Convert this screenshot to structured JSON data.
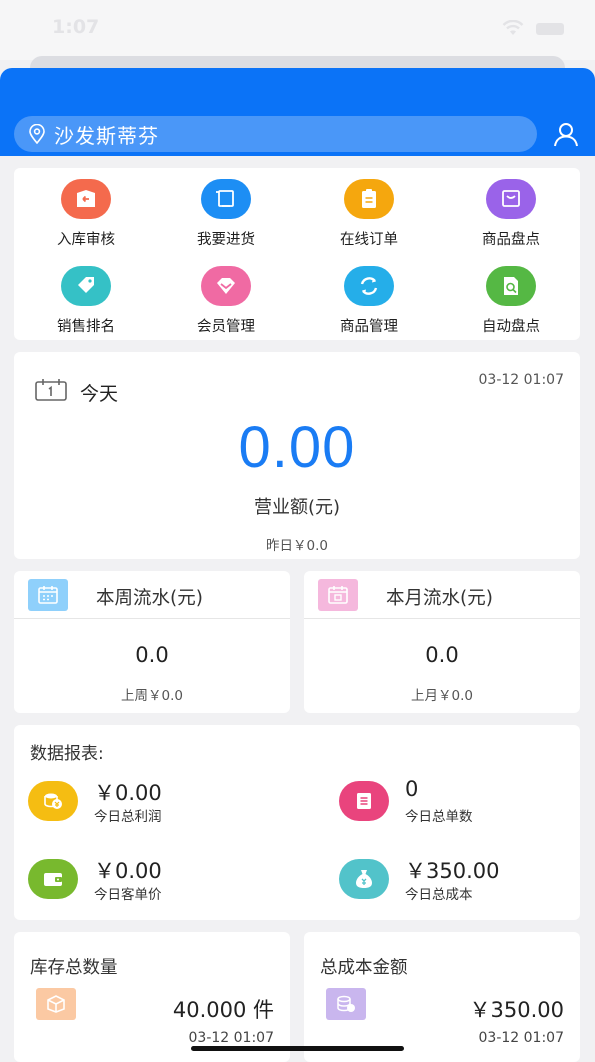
{
  "status_bar": {
    "time": "1:07"
  },
  "header": {
    "store_name": "沙发斯蒂芬"
  },
  "menu": [
    {
      "label": "入库审核",
      "icon": "inbound-review-icon",
      "color": "#f46a4d"
    },
    {
      "label": "我要进货",
      "icon": "purchase-cart-icon",
      "color": "#1d8ef4"
    },
    {
      "label": "在线订单",
      "icon": "clipboard-icon",
      "color": "#f5a70e"
    },
    {
      "label": "商品盘点",
      "icon": "inventory-box-icon",
      "color": "#9a63e9"
    },
    {
      "label": "销售排名",
      "icon": "tag-icon",
      "color": "#35c1c6"
    },
    {
      "label": "会员管理",
      "icon": "diamond-icon",
      "color": "#f06aa3"
    },
    {
      "label": "商品管理",
      "icon": "recycle-icon",
      "color": "#25aee9"
    },
    {
      "label": "自动盘点",
      "icon": "auto-check-icon",
      "color": "#55b844"
    }
  ],
  "today": {
    "label": "今天",
    "time": "03-12 01:07",
    "value": "0.00",
    "subtitle": "营业额(元)",
    "yesterday": "昨日￥0.0"
  },
  "week": {
    "title": "本周流水(元)",
    "value": "0.0",
    "prev": "上周￥0.0",
    "color": "#8fd0fb"
  },
  "month": {
    "title": "本月流水(元)",
    "value": "0.0",
    "prev": "上月￥0.0",
    "color": "#f5b8dd"
  },
  "report": {
    "title": "数据报表:",
    "stats": [
      {
        "value": "￥0.00",
        "label": "今日总利润",
        "icon": "coins-icon",
        "color": "#f5bd12"
      },
      {
        "value": "0",
        "label": "今日总单数",
        "icon": "document-icon",
        "color": "#e9447d"
      },
      {
        "value": "￥0.00",
        "label": "今日客单价",
        "icon": "wallet-icon",
        "color": "#78b92e"
      },
      {
        "value": "￥350.00",
        "label": "今日总成本",
        "icon": "money-bag-icon",
        "color": "#52c3ca"
      }
    ]
  },
  "inventory": {
    "title": "库存总数量",
    "value": "40.000 件",
    "time": "03-12 01:07",
    "color": "#fbc9a3"
  },
  "cost": {
    "title": "总成本金额",
    "value": "￥350.00",
    "time": "03-12 01:07",
    "color": "#c9b6ee"
  }
}
